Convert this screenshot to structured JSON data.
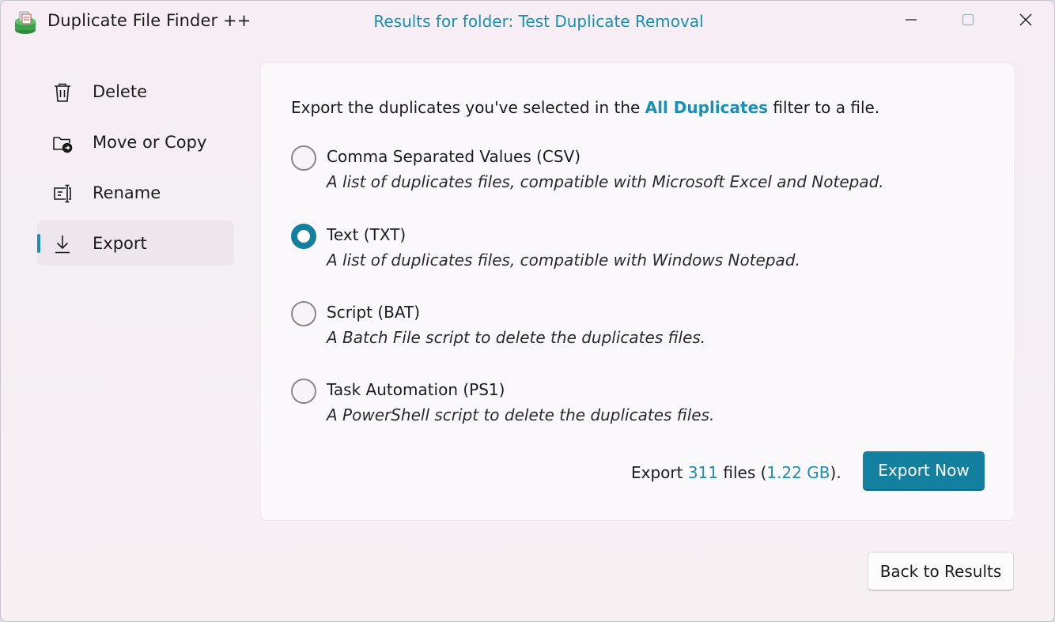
{
  "window": {
    "app_title": "Duplicate File Finder ++",
    "results_title": "Results for folder: Test Duplicate Removal",
    "app_icon": "app-logo-icon",
    "controls": [
      "minimize-icon",
      "maximize-icon",
      "close-icon"
    ]
  },
  "sidebar": {
    "items": [
      {
        "label": "Delete",
        "icon": "trash-icon",
        "active": false
      },
      {
        "label": "Move or Copy",
        "icon": "folder-move-icon",
        "active": false
      },
      {
        "label": "Rename",
        "icon": "rename-icon",
        "active": false
      },
      {
        "label": "Export",
        "icon": "download-icon",
        "active": true
      }
    ]
  },
  "main": {
    "intro_prefix": "Export the duplicates you've selected in the ",
    "intro_highlight": "All Duplicates",
    "intro_suffix": " filter to a file.",
    "options": [
      {
        "title": "Comma Separated Values (CSV)",
        "description": "A list of duplicates files, compatible with Microsoft Excel and Notepad.",
        "checked": false
      },
      {
        "title": "Text (TXT)",
        "description": "A list of duplicates files, compatible with Windows Notepad.",
        "checked": true
      },
      {
        "title": "Script (BAT)",
        "description": "A Batch File script to delete the duplicates files.",
        "checked": false
      },
      {
        "title": "Task Automation (PS1)",
        "description": "A PowerShell script to delete the duplicates files.",
        "checked": false
      }
    ],
    "summary": {
      "prefix": "Export ",
      "count": "311",
      "middle": " files (",
      "size": "1.22 GB",
      "suffix": ")."
    },
    "export_button": "Export Now"
  },
  "footer": {
    "back_button": "Back to Results"
  },
  "colors": {
    "accent": "#13809f",
    "link": "#1a8fb3"
  }
}
